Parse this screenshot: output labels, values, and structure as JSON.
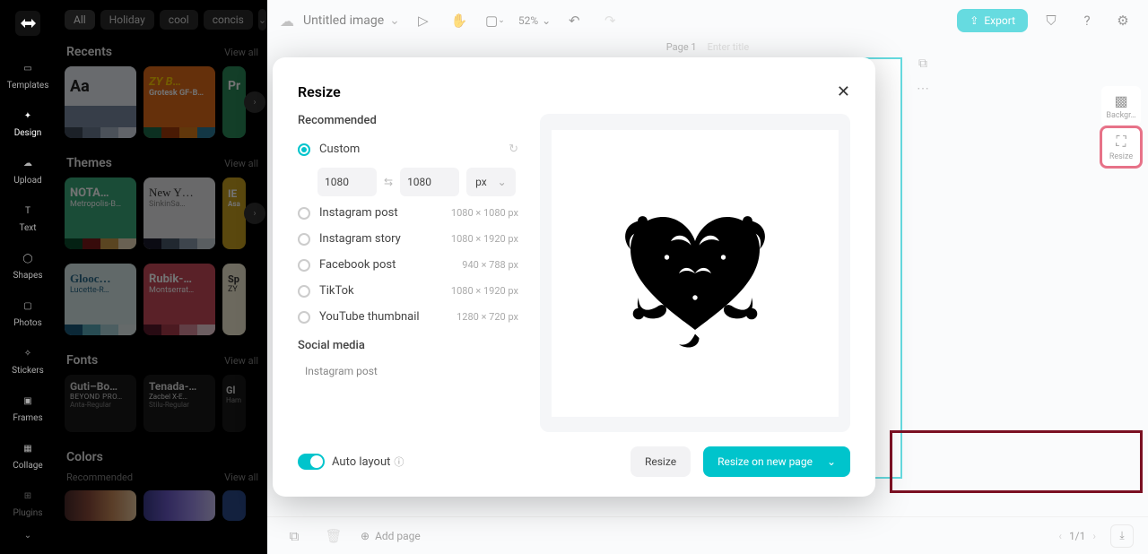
{
  "nav": {
    "items": [
      {
        "label": "Templates"
      },
      {
        "label": "Design"
      },
      {
        "label": "Upload"
      },
      {
        "label": "Text"
      },
      {
        "label": "Shapes"
      },
      {
        "label": "Photos"
      },
      {
        "label": "Stickers"
      },
      {
        "label": "Frames"
      },
      {
        "label": "Collage"
      },
      {
        "label": "Plugins"
      }
    ]
  },
  "chips": {
    "all": "All",
    "holiday": "Holiday",
    "cool": "cool",
    "concise": "concis"
  },
  "sections": {
    "recents": {
      "title": "Recents",
      "viewall": "View all",
      "cards": [
        {
          "l1": "Aa"
        },
        {
          "l1": "ZY B…",
          "l2": "Grotesk GF-B…"
        },
        {
          "l1": "Pr"
        }
      ]
    },
    "themes": {
      "title": "Themes",
      "viewall": "View all",
      "cards": [
        {
          "l1": "NOTA…",
          "l2": "Metropolis-B…"
        },
        {
          "l1": "New Y…",
          "l2": "SinkinSa…"
        },
        {
          "l1": "IE",
          "l2": "Asa"
        },
        {
          "l1": "Glooc…",
          "l2": "Lucette-R…"
        },
        {
          "l1": "Rubik-…",
          "l2": "Montserrat…"
        },
        {
          "l1": "Sp",
          "l2": "ZY"
        }
      ]
    },
    "fonts": {
      "title": "Fonts",
      "viewall": "View all",
      "cards": [
        {
          "l1": "Guti–Bo…",
          "l2": "BEYOND PRO…",
          "l3": "Anta-Regular"
        },
        {
          "l1": "Tenada-…",
          "l2": "Zacbel X-E…",
          "l3": "Stilu-Regular"
        },
        {
          "l1": "Gl",
          "l2": "Ham"
        }
      ]
    },
    "colors": {
      "title": "Colors",
      "rec": "Recommended",
      "viewall": "View all"
    }
  },
  "topbar": {
    "title": "Untitled image",
    "zoom": "52%",
    "export": "Export"
  },
  "page": {
    "label": "Page 1",
    "hint": "Enter title"
  },
  "rightTools": {
    "bg": "Backgr…",
    "resize": "Resize"
  },
  "bottom": {
    "add": "Add page",
    "counter": "1/1"
  },
  "modal": {
    "title": "Resize",
    "recommended": "Recommended",
    "custom": "Custom",
    "w": "1080",
    "h": "1080",
    "unit": "px",
    "options": [
      {
        "name": "Instagram post",
        "dim": "1080 × 1080 px"
      },
      {
        "name": "Instagram story",
        "dim": "1080 × 1920 px"
      },
      {
        "name": "Facebook post",
        "dim": "940 × 788 px"
      },
      {
        "name": "TikTok",
        "dim": "1080 × 1920 px"
      },
      {
        "name": "YouTube thumbnail",
        "dim": "1280 × 720 px"
      }
    ],
    "social": "Social media",
    "socialItem": "Instagram post",
    "auto": "Auto layout",
    "resizeBtn": "Resize",
    "newPageBtn": "Resize on new page"
  }
}
